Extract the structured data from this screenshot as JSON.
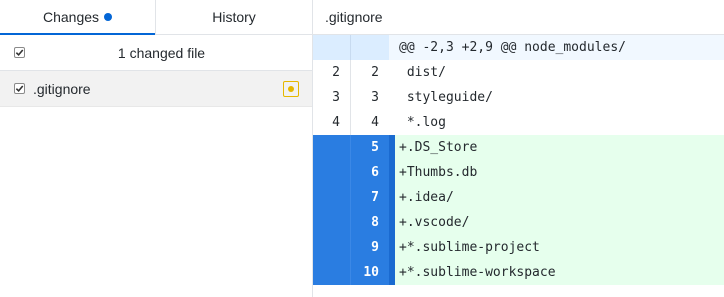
{
  "tabs": {
    "changes": "Changes",
    "history": "History"
  },
  "changes_header": {
    "label": "1 changed file"
  },
  "files": [
    {
      "name": ".gitignore",
      "status": "modified"
    }
  ],
  "diff_file": {
    "title": ".gitignore"
  },
  "hunk_header": "@@ -2,3 +2,9 @@ node_modules/",
  "lines": [
    {
      "type": "context",
      "old": "2",
      "new": "2",
      "text": " dist/"
    },
    {
      "type": "context",
      "old": "3",
      "new": "3",
      "text": " styleguide/"
    },
    {
      "type": "context",
      "old": "4",
      "new": "4",
      "text": " *.log"
    },
    {
      "type": "add",
      "old": "",
      "new": "5",
      "text": "+.DS_Store"
    },
    {
      "type": "add",
      "old": "",
      "new": "6",
      "text": "+Thumbs.db"
    },
    {
      "type": "add",
      "old": "",
      "new": "7",
      "text": "+.idea/"
    },
    {
      "type": "add",
      "old": "",
      "new": "8",
      "text": "+.vscode/"
    },
    {
      "type": "add",
      "old": "",
      "new": "9",
      "text": "+*.sublime-project"
    },
    {
      "type": "add",
      "old": "",
      "new": "10",
      "text": "+*.sublime-workspace"
    }
  ],
  "colors": {
    "accent": "#0366d6",
    "added_bg": "#e6ffed",
    "selected_gutter": "#2a7de1",
    "modified_icon": "#e6b800"
  }
}
